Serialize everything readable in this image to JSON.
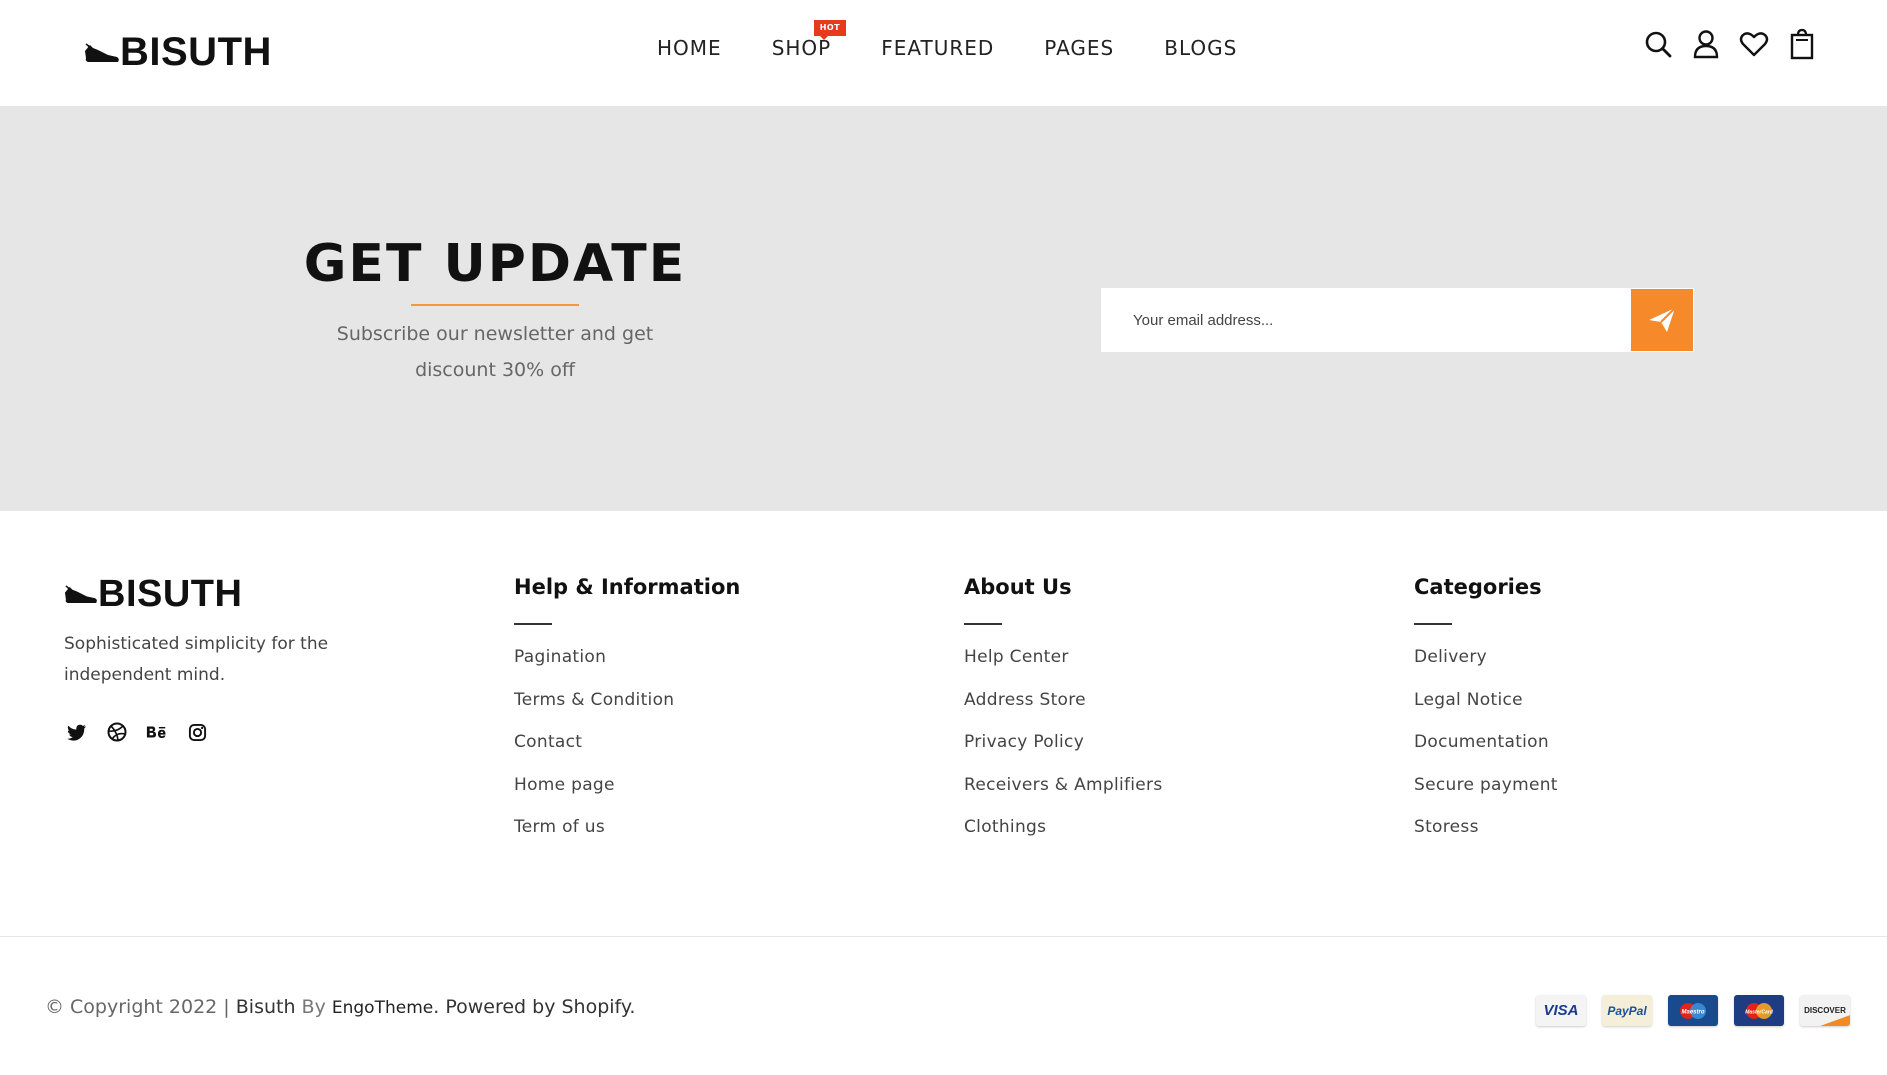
{
  "header": {
    "logo": "BISUTH",
    "nav": [
      {
        "label": "HOME"
      },
      {
        "label": "SHOP",
        "badge": "HOT"
      },
      {
        "label": "FEATURED"
      },
      {
        "label": "PAGES"
      },
      {
        "label": "BLOGS"
      }
    ],
    "icons": [
      "search-icon",
      "user-icon",
      "heart-icon",
      "shopping-bag-icon"
    ]
  },
  "newsletter": {
    "title": "GET UPDATE",
    "subtitle": "Subscribe our newsletter and get discount 30% off",
    "email_placeholder": "Your email address...",
    "submit_icon": "paper-plane-icon"
  },
  "footer": {
    "logo": "BISUTH",
    "about": "Sophisticated simplicity for the independent mind.",
    "socials": [
      "twitter-icon",
      "dribbble-icon",
      "behance-icon",
      "instagram-icon"
    ],
    "columns": [
      {
        "title": "Help & Information",
        "links": [
          "Pagination",
          "Terms & Condition",
          "Contact",
          "Home page",
          "Term of us"
        ]
      },
      {
        "title": "About Us",
        "links": [
          "Help Center",
          "Address Store",
          "Privacy Policy",
          "Receivers & Amplifiers",
          "Clothings"
        ]
      },
      {
        "title": "Categories",
        "links": [
          "Delivery",
          "Legal Notice",
          "Documentation",
          "Secure payment",
          "Storess"
        ]
      }
    ],
    "copyright": {
      "prefix": "© Copyright 2022 | ",
      "brand": "Bisuth",
      "by": " By ",
      "engo": "EngoTheme",
      "powered": ". Powered by Shopify."
    },
    "payments": [
      "VISA",
      "PayPal",
      "Maestro",
      "MasterCard",
      "DISCOVER"
    ]
  },
  "colors": {
    "accent": "#f68a2b",
    "hot_badge": "#e53a1c",
    "newsletter_bg": "#e6e6e6"
  }
}
